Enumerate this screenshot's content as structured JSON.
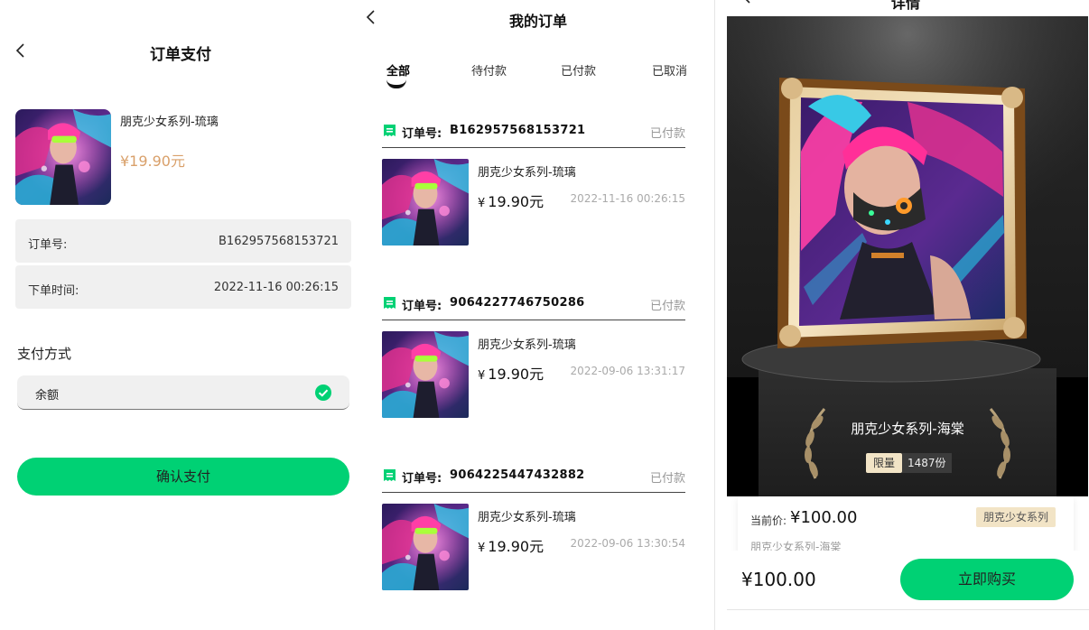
{
  "colors": {
    "accent_green": "#00d174",
    "price_gold": "#d9a06a",
    "tag_beige": "#f2e4c6"
  },
  "pay": {
    "title": "订单支付",
    "product_name": "朋克少女系列-琉璃",
    "product_price": "¥19.90元",
    "order_no_label": "订单号:",
    "order_no": "B162957568153721",
    "order_time_label": "下单时间:",
    "order_time": "2022-11-16 00:26:15",
    "method_label": "支付方式",
    "method_option": "余额",
    "confirm_label": "确认支付"
  },
  "orders": {
    "title": "我的订单",
    "tabs": [
      "全部",
      "待付款",
      "已付款",
      "已取消"
    ],
    "active_tab": "全部",
    "order_no_label": "订单号:",
    "items": [
      {
        "order_no": "B162957568153721",
        "status": "已付款",
        "name": "朋克少女系列-琉璃",
        "currency": "¥",
        "price": "19.90元",
        "time": "2022-11-16 00:26:15"
      },
      {
        "order_no": "9064227746750286",
        "status": "已付款",
        "name": "朋克少女系列-琉璃",
        "currency": "¥",
        "price": "19.90元",
        "time": "2022-09-06 13:31:17"
      },
      {
        "order_no": "9064225447432882",
        "status": "已付款",
        "name": "朋克少女系列-琉璃",
        "currency": "¥",
        "price": "19.90元",
        "time": "2022-09-06 13:30:54"
      }
    ]
  },
  "detail": {
    "title": "详情",
    "hero_name": "朋克少女系列-海棠",
    "limit_tag": "限量",
    "limit_count": "1487份",
    "current_price_label": "当前价:",
    "current_price": "¥100.00",
    "series_tag": "朋克少女系列",
    "sub_name": "朋克少女系列-海棠",
    "buy_price": "¥100.00",
    "buy_label": "立即购买"
  }
}
